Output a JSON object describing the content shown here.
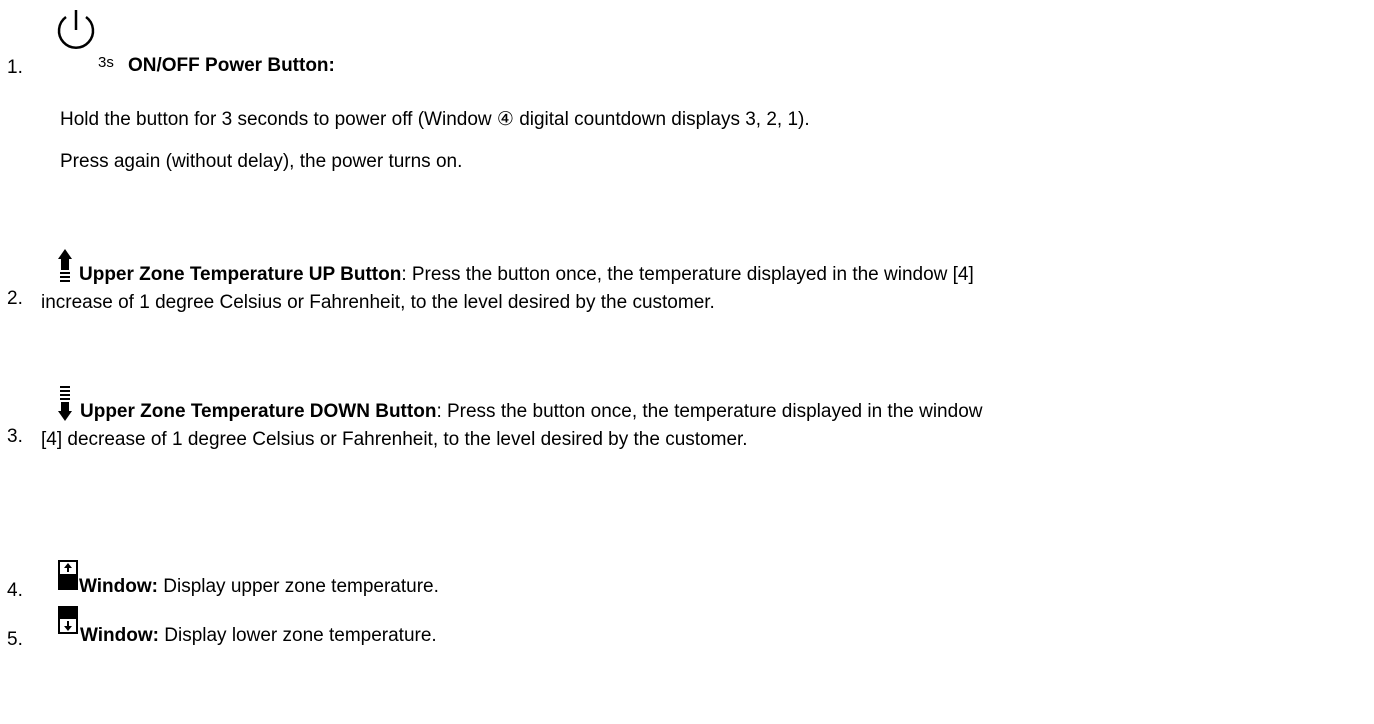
{
  "items": [
    {
      "number": "1.",
      "icon": "power-icon",
      "icon_suffix": "3s",
      "title": "ON/OFF Power Button:",
      "paragraphs": [
        "Hold the button for 3 seconds to power off (Window ④ digital countdown displays 3, 2, 1).",
        "Press again (without delay), the power turns on."
      ]
    },
    {
      "number": "2.",
      "icon": "temperature-up-icon",
      "title": "Upper Zone Temperature UP Button",
      "line1": ": Press the button once, the temperature displayed in the window [4]",
      "line2": "increase of 1 degree Celsius or Fahrenheit, to the level desired by the customer."
    },
    {
      "number": "3.",
      "icon": "temperature-down-icon",
      "title": "Upper Zone Temperature DOWN Button",
      "line1": ": Press the button once, the temperature displayed in the window",
      "line2": "[4] decrease of 1 degree Celsius or Fahrenheit, to the level desired by the customer."
    },
    {
      "number": "4.",
      "icon": "upper-zone-window-icon",
      "title": "Window:",
      "text": " Display upper zone temperature."
    },
    {
      "number": "5.",
      "icon": "lower-zone-window-icon",
      "title": "Window:",
      "text": " Display lower zone temperature."
    }
  ]
}
